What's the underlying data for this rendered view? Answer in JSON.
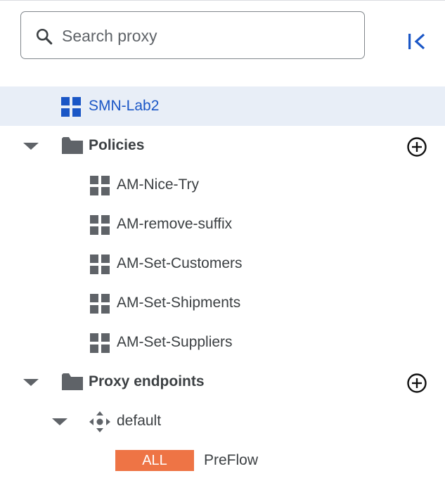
{
  "search": {
    "placeholder": "Search proxy",
    "value": ""
  },
  "tree": {
    "root": {
      "label": "SMN-Lab2",
      "icon": "grid-blue-icon"
    },
    "policies": {
      "label": "Policies",
      "icon": "folder-icon",
      "items": [
        {
          "label": "AM-Nice-Try"
        },
        {
          "label": "AM-remove-suffix"
        },
        {
          "label": "AM-Set-Customers"
        },
        {
          "label": "AM-Set-Shipments"
        },
        {
          "label": "AM-Set-Suppliers"
        }
      ]
    },
    "proxy_endpoints": {
      "label": "Proxy endpoints",
      "icon": "folder-icon",
      "endpoint": {
        "label": "default",
        "icon": "move-arrows-icon",
        "flow": {
          "badge": "ALL",
          "label": "PreFlow"
        }
      }
    }
  },
  "colors": {
    "selected_bg": "#e8eef7",
    "link_blue": "#1a56c6",
    "badge_orange": "#ee7445",
    "icon_grey": "#5f6368"
  }
}
